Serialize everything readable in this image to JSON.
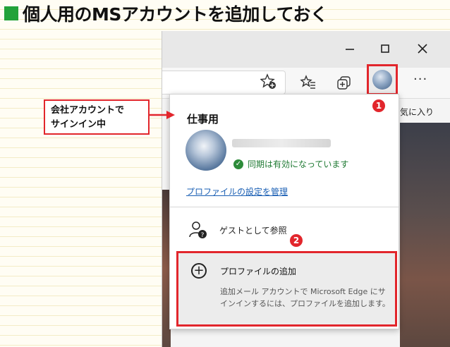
{
  "heading": {
    "text": "個人用のMSアカウントを追加しておく"
  },
  "callout": {
    "line1": "会社アカウントで",
    "line2": "サインイン中"
  },
  "browser": {
    "favorites_partial": "気に入り",
    "more_label": "···"
  },
  "profile_menu": {
    "title": "仕事用",
    "sync_status": "同期は有効になっています",
    "manage_link": "プロファイルの設定を管理",
    "guest_label": "ゲストとして参照",
    "add_label": "プロファイルの追加",
    "add_description": "追加メール アカウントで Microsoft Edge にサインインするには、プロファイルを追加します。"
  },
  "badges": {
    "step1": "1",
    "step2": "2"
  },
  "colors": {
    "accent_red": "#e2262c",
    "heading_square": "#22a23a",
    "sync_green": "#2d8b3a",
    "link_blue": "#1a5fb4"
  }
}
